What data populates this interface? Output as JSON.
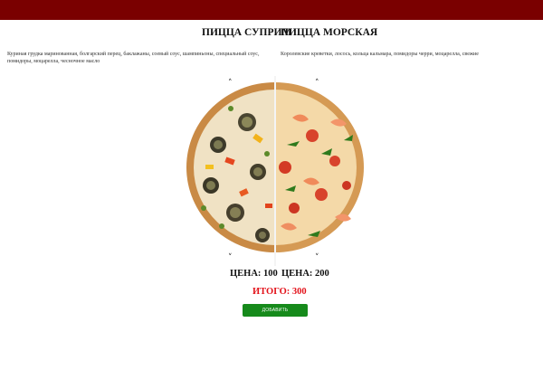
{
  "header": {
    "bar_color": "#7a0000"
  },
  "left_pizza": {
    "title": "ПИЦЦА СУПРИМ",
    "description": "Куриная грудка маринованная, болгарский перец, баклажаны, соевый соус, шампиньоны, специальный соус, помидоры, моцарелла, чесночное масло",
    "price_label": "ЦЕНА: 100"
  },
  "right_pizza": {
    "title": "ПИЦЦА МОРСКАЯ",
    "description": "Королевские креветки, лосось, кольца кальмара, помидоры черри, моцарелла, свежие",
    "price_label": "ЦЕНА: 200"
  },
  "total_label": "ИТОГО: 300",
  "add_button_label": "ДОБАВИТЬ",
  "icons": {
    "up": "˄",
    "down": "˅"
  },
  "colors": {
    "total": "#e3121a",
    "button": "#168a1b"
  }
}
